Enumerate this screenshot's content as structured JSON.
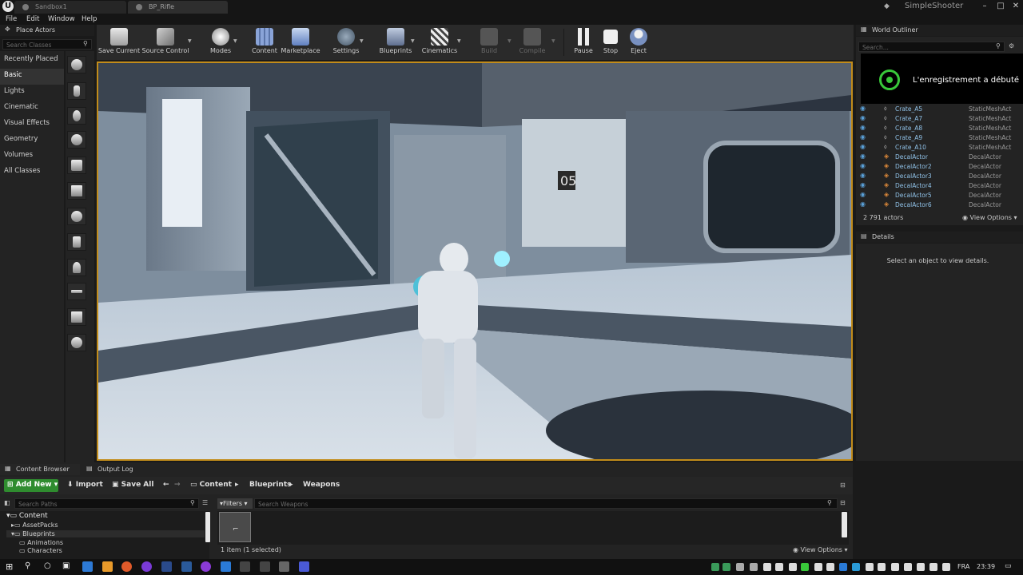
{
  "window": {
    "tabs": [
      "Sandbox1",
      "BP_Rifle"
    ],
    "project_name": "SimpleShooter",
    "controls": [
      "–",
      "□",
      "✕"
    ]
  },
  "menu": [
    "File",
    "Edit",
    "Window",
    "Help"
  ],
  "place_actors": {
    "title": "Place Actors",
    "search_placeholder": "Search Classes",
    "categories": [
      "Recently Placed",
      "Basic",
      "Lights",
      "Cinematic",
      "Visual Effects",
      "Geometry",
      "Volumes",
      "All Classes"
    ],
    "selected": "Basic"
  },
  "toolbar": {
    "buttons": [
      {
        "label": "Save Current",
        "icon": "save-icon",
        "enabled": true
      },
      {
        "label": "Source Control",
        "icon": "source-control-icon",
        "enabled": true
      },
      {
        "label": "Modes",
        "icon": "modes-icon",
        "enabled": true
      },
      {
        "label": "Content",
        "icon": "content-icon",
        "enabled": true
      },
      {
        "label": "Marketplace",
        "icon": "marketplace-icon",
        "enabled": true
      },
      {
        "label": "Settings",
        "icon": "settings-icon",
        "enabled": true
      },
      {
        "label": "Blueprints",
        "icon": "blueprints-icon",
        "enabled": true
      },
      {
        "label": "Cinematics",
        "icon": "cinematics-icon",
        "enabled": true
      },
      {
        "label": "Build",
        "icon": "build-icon",
        "enabled": false
      },
      {
        "label": "Compile",
        "icon": "compile-icon",
        "enabled": false
      },
      {
        "label": "Pause",
        "icon": "pause-icon",
        "enabled": true
      },
      {
        "label": "Stop",
        "icon": "stop-icon",
        "enabled": true
      },
      {
        "label": "Eject",
        "icon": "eject-icon",
        "enabled": true
      }
    ]
  },
  "viewport": {
    "border_color": "#c28c1a",
    "sign_text": "05"
  },
  "outliner": {
    "title": "World Outliner",
    "search_placeholder": "Search...",
    "toast": "L'enregistrement a débuté",
    "rows": [
      {
        "name": "Crate_A5",
        "type": "StaticMeshAct"
      },
      {
        "name": "Crate_A7",
        "type": "StaticMeshAct"
      },
      {
        "name": "Crate_A8",
        "type": "StaticMeshAct"
      },
      {
        "name": "Crate_A9",
        "type": "StaticMeshAct"
      },
      {
        "name": "Crate_A10",
        "type": "StaticMeshAct"
      },
      {
        "name": "DecalActor",
        "type": "DecalActor"
      },
      {
        "name": "DecalActor2",
        "type": "DecalActor"
      },
      {
        "name": "DecalActor3",
        "type": "DecalActor"
      },
      {
        "name": "DecalActor4",
        "type": "DecalActor"
      },
      {
        "name": "DecalActor5",
        "type": "DecalActor"
      },
      {
        "name": "DecalActor6",
        "type": "DecalActor"
      }
    ],
    "actor_count": "2 791 actors",
    "view_options": "View Options"
  },
  "details": {
    "title": "Details",
    "empty_message": "Select an object to view details."
  },
  "content_browser": {
    "tabs": [
      "Content Browser",
      "Output Log"
    ],
    "add_new": "Add New",
    "import": "Import",
    "save_all": "Save All",
    "breadcrumb": [
      "Content",
      "Blueprints",
      "Weapons"
    ],
    "path_search_placeholder": "Search Paths",
    "filters": "Filters",
    "asset_search_placeholder": "Search Weapons",
    "tree": [
      "Content",
      "AssetPacks",
      "Blueprints",
      "Animations",
      "Characters"
    ],
    "item_count": "1 item (1 selected)",
    "view_options": "View Options"
  },
  "taskbar": {
    "language": "FRA",
    "time": "23:39"
  },
  "colors": {
    "accent_green": "#2f8c2f",
    "record_green": "#39c83a",
    "selection_blue": "#8fc0e6"
  }
}
